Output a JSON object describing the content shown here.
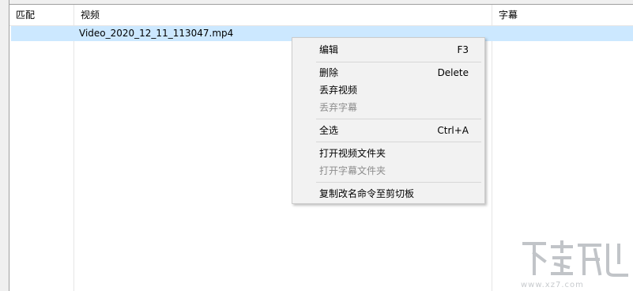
{
  "columns": [
    {
      "label": "匹配"
    },
    {
      "label": "视频"
    },
    {
      "label": "字幕"
    }
  ],
  "rows": [
    {
      "match": "",
      "video": "Video_2020_12_11_113047.mp4",
      "subtitle": ""
    }
  ],
  "context_menu": {
    "items": [
      {
        "label": "编辑",
        "shortcut": "F3",
        "enabled": true
      },
      {
        "label": "删除",
        "shortcut": "Delete",
        "enabled": true
      },
      {
        "label": "丢弃视频",
        "shortcut": "",
        "enabled": true
      },
      {
        "label": "丢弃字幕",
        "shortcut": "",
        "enabled": false
      },
      {
        "label": "全选",
        "shortcut": "Ctrl+A",
        "enabled": true
      },
      {
        "label": "打开视频文件夹",
        "shortcut": "",
        "enabled": true
      },
      {
        "label": "打开字幕文件夹",
        "shortcut": "",
        "enabled": false
      },
      {
        "label": "复制改名命令至剪切板",
        "shortcut": "",
        "enabled": true
      }
    ]
  },
  "watermark": {
    "text": "www.xz7.com"
  },
  "colors": {
    "selection": "#cce8ff",
    "menu_bg": "#f2f2f2",
    "disabled_text": "#8d8d8d"
  }
}
